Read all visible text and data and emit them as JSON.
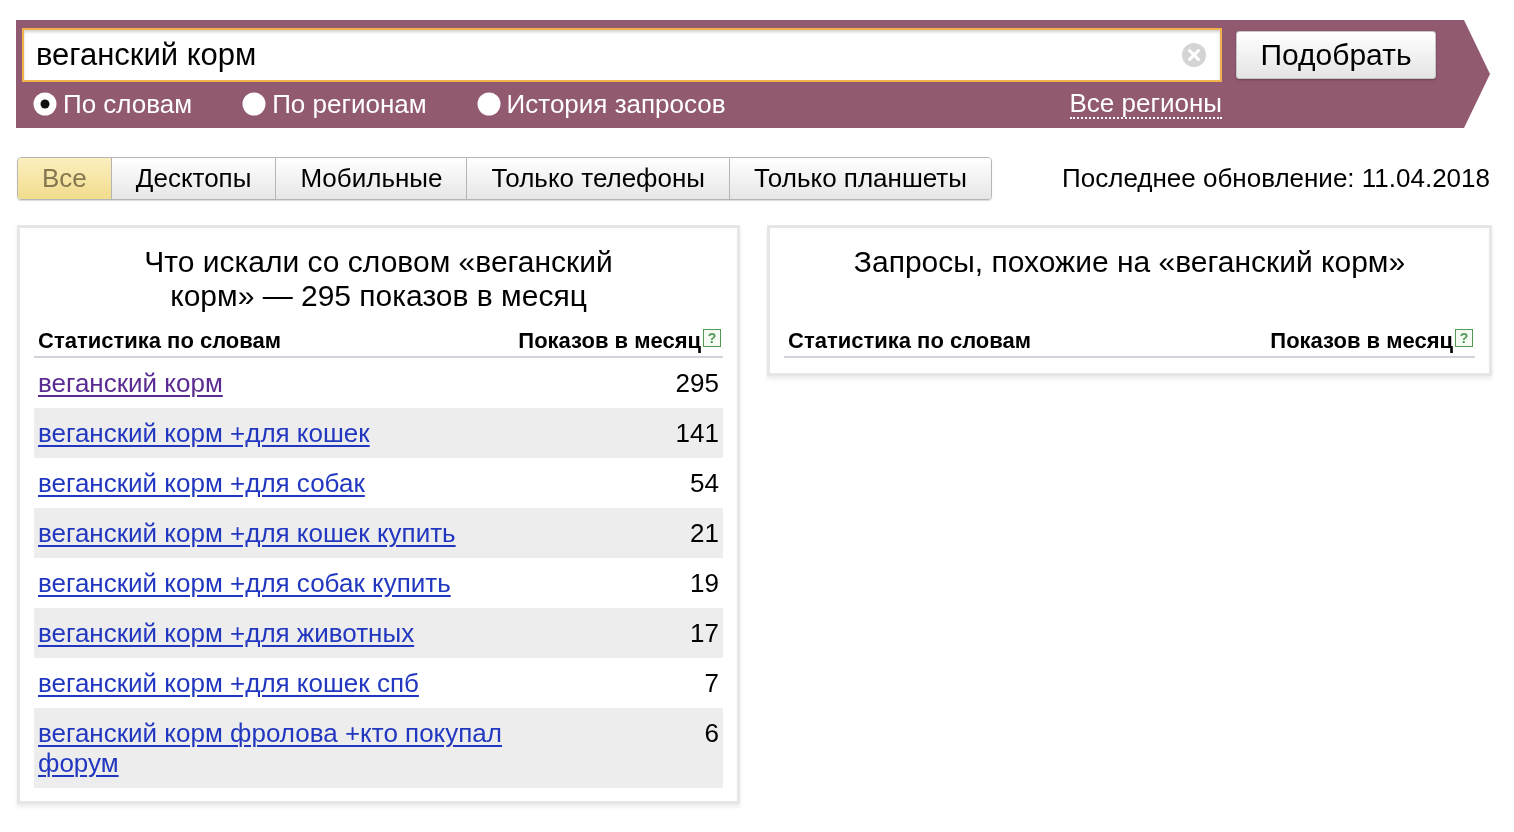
{
  "search": {
    "value": "веганский корм",
    "button": "Подобрать"
  },
  "modes": [
    {
      "label": "По словам",
      "selected": true
    },
    {
      "label": "По регионам",
      "selected": false
    },
    {
      "label": "История запросов",
      "selected": false
    }
  ],
  "regions_link": "Все регионы",
  "device_tabs": [
    {
      "label": "Все",
      "selected": true
    },
    {
      "label": "Десктопы",
      "selected": false
    },
    {
      "label": "Мобильные",
      "selected": false
    },
    {
      "label": "Только телефоны",
      "selected": false
    },
    {
      "label": "Только планшеты",
      "selected": false
    }
  ],
  "last_update": "Последнее обновление: 11.04.2018",
  "panels": [
    {
      "title": "Что искали со словом «веганский корм» — 295 показов в месяц",
      "columns": [
        "Статистика по словам",
        "Показов в месяц"
      ],
      "help_mark": "?",
      "rows": [
        {
          "keyword": "веганский корм",
          "count": "295",
          "visited": true
        },
        {
          "keyword": "веганский корм +для кошек",
          "count": "141",
          "visited": false
        },
        {
          "keyword": "веганский корм +для собак",
          "count": "54",
          "visited": false
        },
        {
          "keyword": "веганский корм +для кошек купить",
          "count": "21",
          "visited": false
        },
        {
          "keyword": "веганский корм +для собак купить",
          "count": "19",
          "visited": false
        },
        {
          "keyword": "веганский корм +для животных",
          "count": "17",
          "visited": false
        },
        {
          "keyword": "веганский корм +для кошек спб",
          "count": "7",
          "visited": false
        },
        {
          "keyword": "веганский корм фролова +кто покупал форум",
          "count": "6",
          "visited": false
        }
      ]
    },
    {
      "title": "Запросы, похожие на «веганский корм»",
      "columns": [
        "Статистика по словам",
        "Показов в месяц"
      ],
      "help_mark": "?"
    }
  ]
}
